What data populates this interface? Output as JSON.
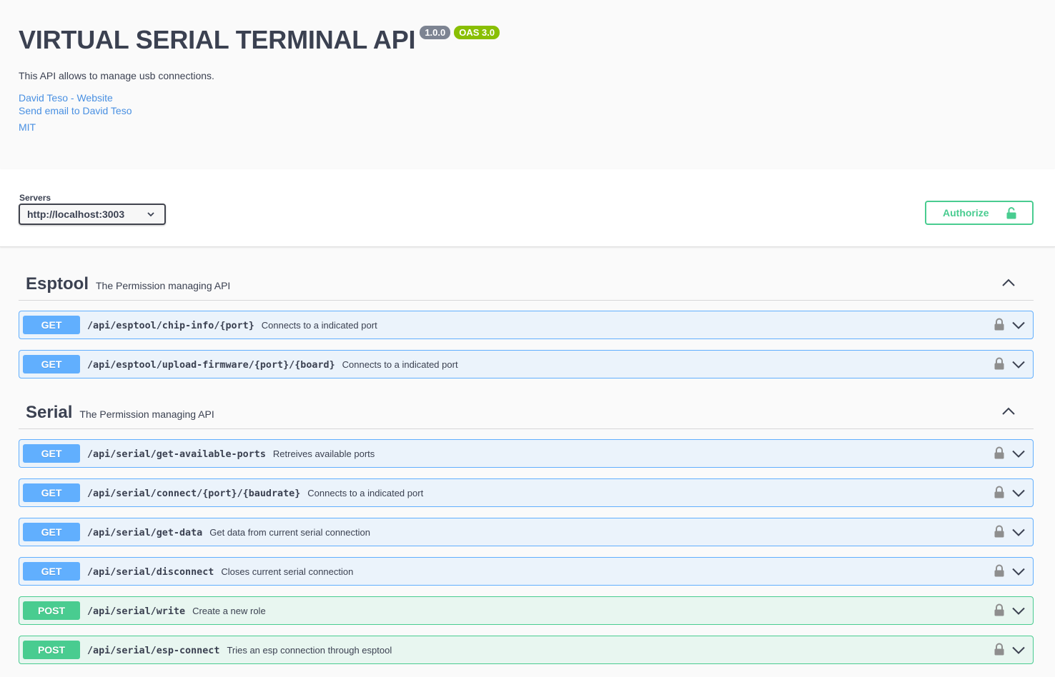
{
  "info": {
    "title": "VIRTUAL SERIAL TERMINAL API",
    "version": "1.0.0",
    "oas": "OAS 3.0",
    "description": "This API allows to manage usb connections.",
    "contact_website": "David Teso - Website",
    "contact_email": "Send email to David Teso",
    "license": "MIT"
  },
  "servers": {
    "label": "Servers",
    "selected": "http://localhost:3003"
  },
  "authorize": {
    "label": "Authorize"
  },
  "colors": {
    "get": "#61affe",
    "post": "#49cc90",
    "text": "#3b4151",
    "link": "#4990e2"
  },
  "tags": [
    {
      "name": "Esptool",
      "description": "The Permission managing API",
      "operations": [
        {
          "method": "GET",
          "path": "/api/esptool/chip-info/{port}",
          "summary": "Connects to a indicated port"
        },
        {
          "method": "GET",
          "path": "/api/esptool/upload-firmware/{port}/{board}",
          "summary": "Connects to a indicated port"
        }
      ]
    },
    {
      "name": "Serial",
      "description": "The Permission managing API",
      "operations": [
        {
          "method": "GET",
          "path": "/api/serial/get-available-ports",
          "summary": "Retreives available ports"
        },
        {
          "method": "GET",
          "path": "/api/serial/connect/{port}/{baudrate}",
          "summary": "Connects to a indicated port"
        },
        {
          "method": "GET",
          "path": "/api/serial/get-data",
          "summary": "Get data from current serial connection"
        },
        {
          "method": "GET",
          "path": "/api/serial/disconnect",
          "summary": "Closes current serial connection"
        },
        {
          "method": "POST",
          "path": "/api/serial/write",
          "summary": "Create a new role"
        },
        {
          "method": "POST",
          "path": "/api/serial/esp-connect",
          "summary": "Tries an esp connection through esptool"
        }
      ]
    }
  ]
}
